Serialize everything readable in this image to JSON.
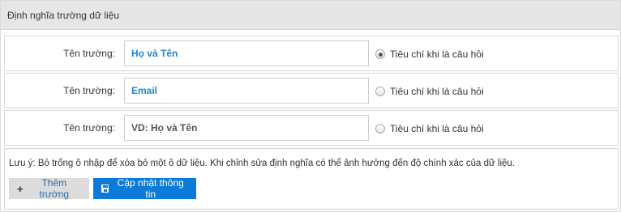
{
  "panel": {
    "title": "Định nghĩa trường dữ liệu"
  },
  "fields": [
    {
      "label": "Tên trường:",
      "value": "Họ và Tên",
      "placeholder": "",
      "radio_label": "Tiêu chí khi là câu hỏi",
      "radio_checked": true
    },
    {
      "label": "Tên trường:",
      "value": "Email",
      "placeholder": "",
      "radio_label": "Tiêu chí khi là câu hỏi",
      "radio_checked": false
    },
    {
      "label": "Tên trường:",
      "value": "",
      "placeholder": "VD: Họ và Tên",
      "radio_label": "Tiêu chí khi là câu hỏi",
      "radio_checked": false
    }
  ],
  "note": "Lưu ý: Bỏ trống ô nhập để xóa bỏ một ô dữ liệu. Khi chỉnh sửa định nghĩa có thể ảnh hưởng đến độ chính xác của dữ liệu.",
  "buttons": {
    "add_label": "Thêm trường",
    "update_label": "Cập nhật thông tin"
  },
  "icons": {
    "add": "plus-icon",
    "update": "save-icon"
  },
  "colors": {
    "accent": "#0b7ad8",
    "value_text": "#1f86c8",
    "header_bg": "#e6e6e6"
  }
}
